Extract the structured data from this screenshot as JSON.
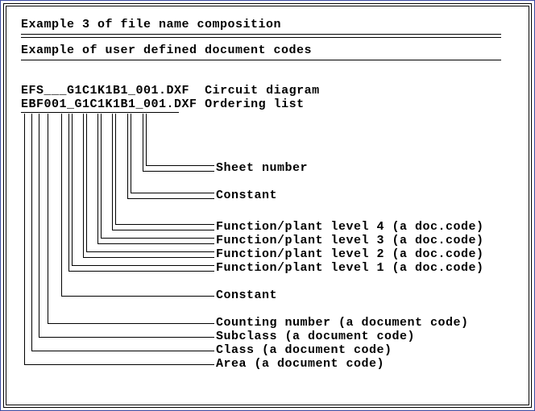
{
  "title": "Example 3 of file name composition",
  "subtitle": "Example of user defined document codes",
  "example1_name": "EFS___G1C1K1B1_001.DXF",
  "example1_desc": "Circuit diagram",
  "example2_name": "EBF001_G1C1K1B1_001.DXF",
  "example2_desc": "Ordering list",
  "labels": {
    "sheet_number": "Sheet number",
    "constant_upper": "Constant",
    "fpl4": "Function/plant level 4 (a doc.code)",
    "fpl3": "Function/plant level 3 (a doc.code)",
    "fpl2": "Function/plant level 2 (a doc.code)",
    "fpl1": "Function/plant level 1 (a doc.code)",
    "constant_lower": "Constant",
    "counting": "Counting number (a document code)",
    "subclass": "Subclass (a document code)",
    "class": "Class (a document code)",
    "area": "Area (a document code)"
  }
}
